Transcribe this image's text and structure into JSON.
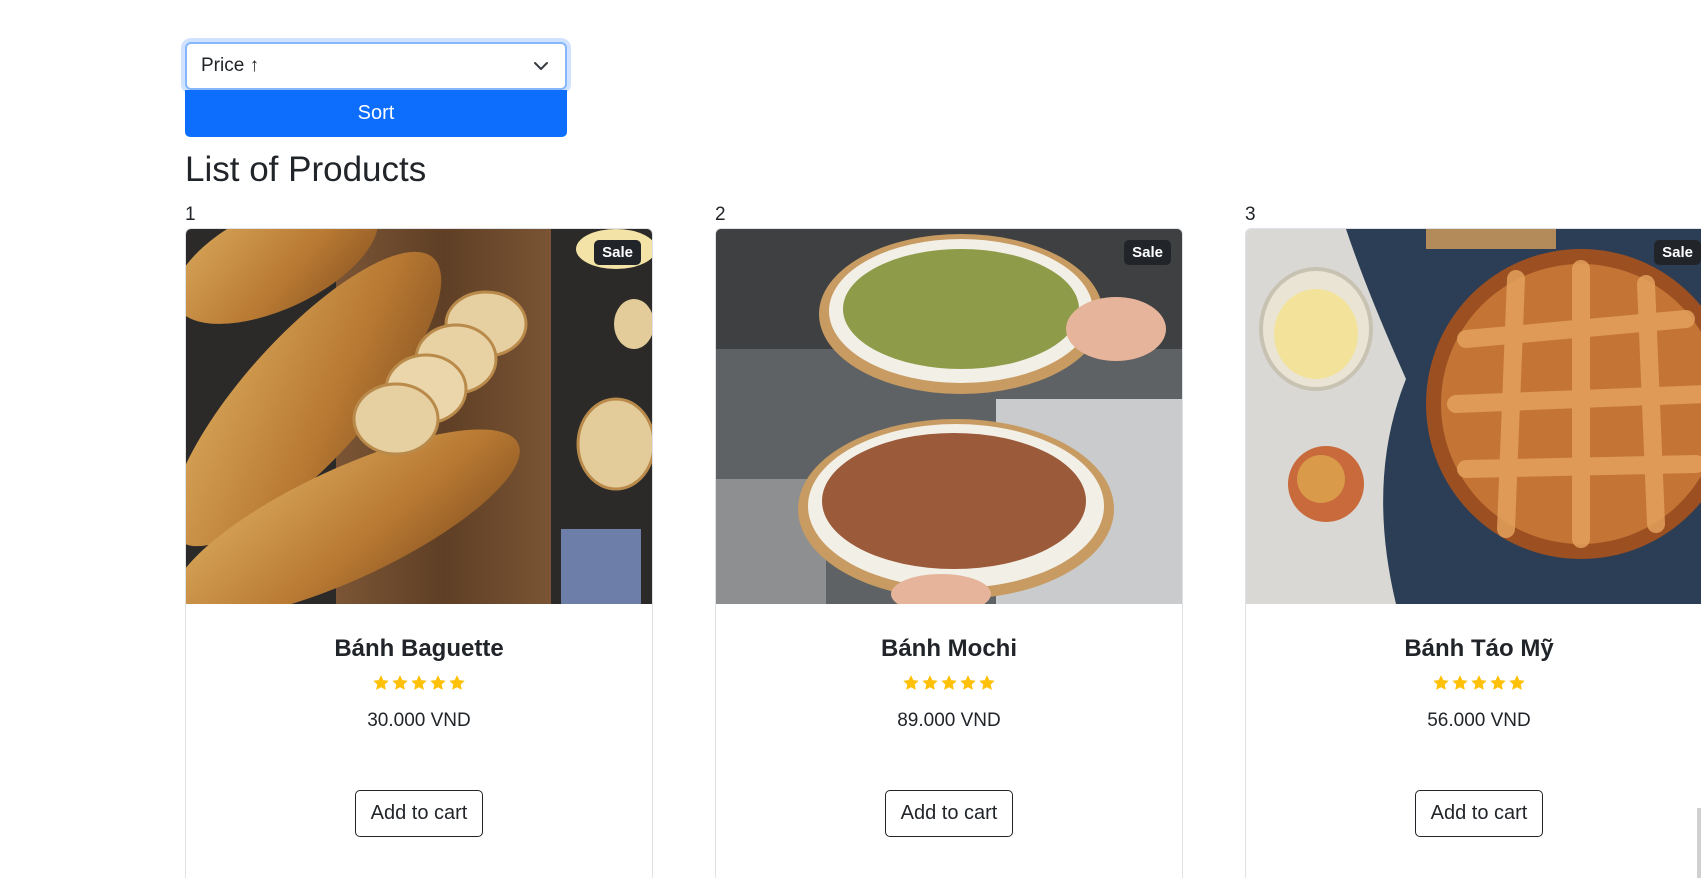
{
  "sort": {
    "selected": "Price ↑",
    "button_label": "Sort"
  },
  "page_title": "List of Products",
  "products": [
    {
      "index": "1",
      "badge": "Sale",
      "name": "Bánh Baguette",
      "rating": 5,
      "price": "30.000 VND",
      "button_label": "Add to cart",
      "image_icon": "baguette-photo"
    },
    {
      "index": "2",
      "badge": "Sale",
      "name": "Bánh Mochi",
      "rating": 5,
      "price": "89.000 VND",
      "button_label": "Add to cart",
      "image_icon": "mochi-photo"
    },
    {
      "index": "3",
      "badge": "Sale",
      "name": "Bánh Táo Mỹ",
      "rating": 5,
      "price": "56.000 VND",
      "button_label": "Add to cart",
      "image_icon": "apple-pie-photo"
    }
  ],
  "colors": {
    "primary": "#0d6efd",
    "star": "#ffc107",
    "dark": "#212529"
  }
}
